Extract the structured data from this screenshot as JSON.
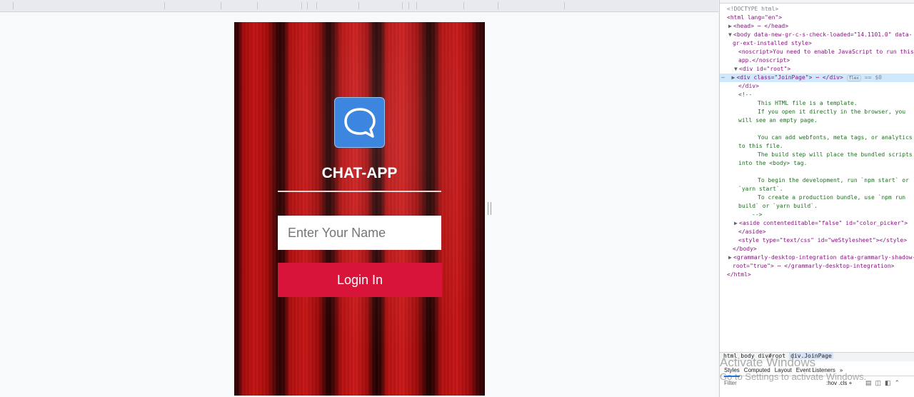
{
  "app": {
    "title": "CHAT-APP",
    "name_placeholder": "Enter Your Name",
    "login_label": "Login In",
    "icon": "chat-bubble-icon",
    "accent": "#d8143a",
    "icon_color": "#3d86e0"
  },
  "devtools": {
    "lines": [
      {
        "t": "<!DOCTYPE html>"
      },
      {
        "t": "<html lang=\"en\">"
      },
      {
        "t": "<head> ⋯ </head>"
      },
      {
        "t": "<body data-new-gr-c-s-check-loaded=\"14.1101.0\" data-"
      },
      {
        "t": "gr-ext-installed style>"
      },
      {
        "t": "<noscript>You need to enable JavaScript to run this"
      },
      {
        "t": "app.</noscript>"
      },
      {
        "t": "<div id=\"root\">"
      },
      {
        "t": "<div class=\"JoinPage\"> ⋯ </div>"
      },
      {
        "t": "</div>"
      },
      {
        "t": "<!--"
      },
      {
        "t": "This HTML file is a template."
      },
      {
        "t": "If you open it directly in the browser, you"
      },
      {
        "t": "will see an empty page."
      },
      {
        "t": ""
      },
      {
        "t": "You can add webfonts, meta tags, or analytics"
      },
      {
        "t": "to this file."
      },
      {
        "t": "The build step will place the bundled scripts"
      },
      {
        "t": "into the <body> tag."
      },
      {
        "t": ""
      },
      {
        "t": "To begin the development, run `npm start` or"
      },
      {
        "t": "`yarn start`."
      },
      {
        "t": "To create a production bundle, use `npm run"
      },
      {
        "t": "build` or `yarn build`."
      },
      {
        "t": "-->"
      },
      {
        "t": "<aside contenteditable=\"false\" id=\"color_picker\">"
      },
      {
        "t": "</aside>"
      },
      {
        "t": "<style type=\"text/css\" id=\"weStylesheet\"></style>"
      },
      {
        "t": "</body>"
      },
      {
        "t": "<grammarly-desktop-integration data-grammarly-shadow-"
      },
      {
        "t": "root=\"true\"> ⋯ </grammarly-desktop-integration>"
      },
      {
        "t": "</html>"
      }
    ],
    "flex_badge": "flex",
    "selected_suffix": "== $0",
    "breadcrumbs": [
      "html",
      "body",
      "div#root",
      "div.JoinPage"
    ],
    "tabs": [
      "Styles",
      "Computed",
      "Layout",
      "Event Listeners",
      "»"
    ],
    "filter_label": "Filter",
    "filter_opts": ":hov  .cls  +",
    "watermark_line1": "Activate Windows",
    "watermark_line2": "Go to Settings to activate Windows."
  }
}
